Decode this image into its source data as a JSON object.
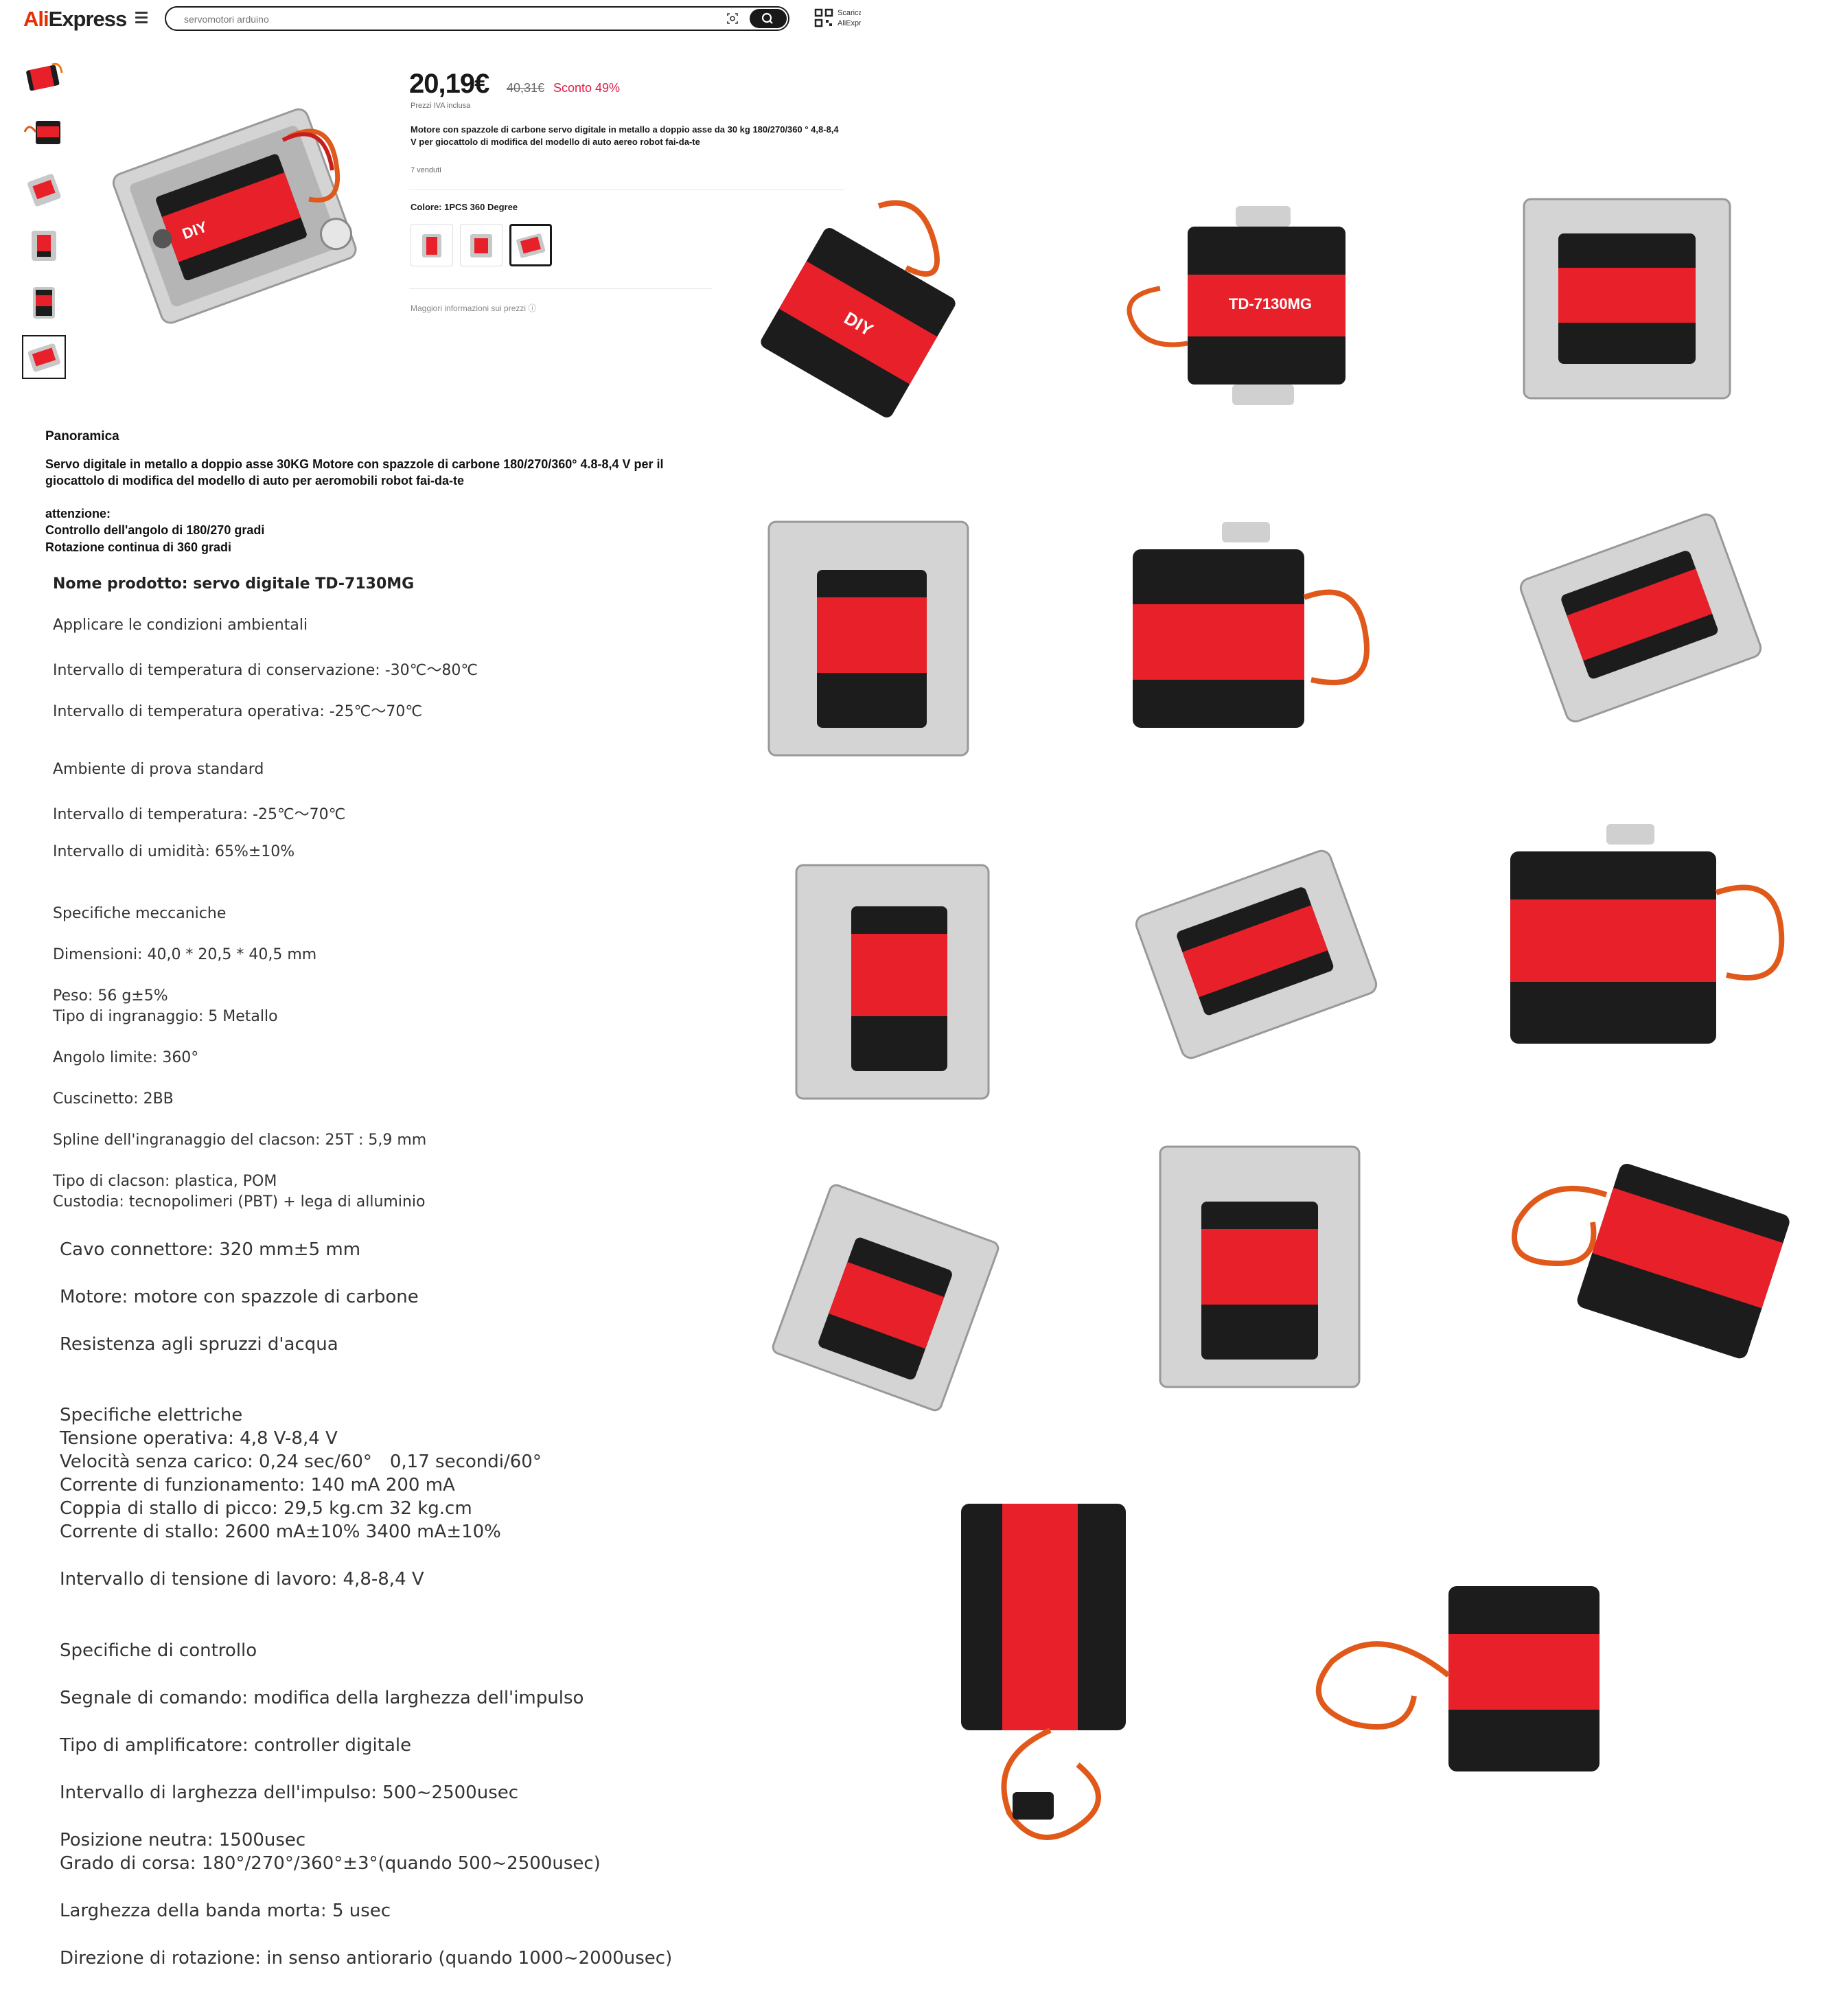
{
  "header": {
    "logo_prefix": "Ali",
    "logo_suffix": "Express",
    "search_placeholder": "servomotori arduino",
    "app_promo_line1": "Scarica",
    "app_promo_line2": "AliExpress"
  },
  "colors": {
    "accent": "#e62e04",
    "discount": "#e11d48",
    "servo_red": "#e8202a",
    "servo_black": "#1c1c1c",
    "bracket": "#c8c8c8"
  },
  "product": {
    "price": "20,19€",
    "old_price": "40,31€",
    "discount": "Sconto 49%",
    "vat_note": "Prezzi IVA inclusa",
    "title": "Motore con spazzole di carbone servo digitale in metallo a doppio asse da 30 kg 180/270/360 ° 4,8-8,4 V per giocattolo di modifica del modello di auto aereo robot fai-da-te",
    "sold": "7 venduti",
    "color_label": "Colore: 1PCS 360 Degree",
    "more_info": "Maggiori informazioni sui prezzi ⓘ"
  },
  "overview": {
    "heading": "Panoramica",
    "intro": "Servo digitale in metallo a doppio asse 30KG Motore con spazzole di carbone 180/270/360° 4.8-8,4 V per il giocattolo di modifica del modello di auto per aeromobili robot fai-da-te",
    "attention": "attenzione:",
    "note1": "Controllo dell'angolo di 180/270 gradi",
    "note2": "Rotazione continua di 360 gradi"
  },
  "specs": {
    "product_name": "Nome prodotto: servo digitale TD-7130MG",
    "env_heading": "Applicare le condizioni ambientali",
    "storage_temp": "Intervallo di temperatura di conservazione: -30℃～80℃",
    "op_temp": "Intervallo di temperatura operativa: -25℃～70℃",
    "test_env": "Ambiente di prova standard",
    "temp_range": "Intervallo di temperatura: -25℃～70℃",
    "humidity": "Intervallo di umidità: 65%±10%",
    "mech_heading": "Specifiche meccaniche",
    "dimensions": "Dimensioni: 40,0 * 20,5 * 40,5 mm",
    "weight": "Peso: 56 g±5%",
    "gear_type": "Tipo di ingranaggio: 5 Metallo",
    "limit_angle": "Angolo limite: 360°",
    "bearing": "Cuscinetto: 2BB",
    "spline": "Spline dell'ingranaggio del clacson: 25T : 5,9 mm",
    "horn_type": "Tipo di clacson: plastica, POM",
    "case": "Custodia: tecnopolimeri (PBT) + lega di alluminio",
    "cable": "Cavo connettore: 320 mm±5 mm",
    "motor": "Motore: motore con spazzole di carbone",
    "splash": "Resistenza agli spruzzi d'acqua",
    "elec_heading": "Specifiche elettriche",
    "voltage": "Tensione operativa: 4,8 V-8,4 V",
    "speed": "Velocità senza carico: 0,24 sec/60°　0,17 secondi/60°",
    "current": "Corrente di funzionamento: 140 mA 200 mA",
    "torque": "Coppia di stallo di picco: 29,5 kg.cm 32 kg.cm",
    "stall_current": "Corrente di stallo: 2600 mA±10% 3400 mA±10%",
    "voltage_range": "Intervallo di tensione di lavoro: 4,8-8,4 V",
    "ctrl_heading": "Specifiche di controllo",
    "signal": "Segnale di comando: modifica della larghezza dell'impulso",
    "amplifier": "Tipo di amplificatore: controller digitale",
    "pulse_range": "Intervallo di larghezza dell'impulso: 500~2500usec",
    "neutral": "Posizione neutra: 1500usec",
    "travel": "Grado di corsa: 180°/270°/360°±3°(quando 500~2500usec)",
    "deadband": "Larghezza della banda morta: 5 usec",
    "rotation": "Direzione di rotazione: in senso antiorario (quando 1000~2000usec)"
  },
  "gallery": {
    "model": "TD-7130MG",
    "brand": "DIY"
  }
}
